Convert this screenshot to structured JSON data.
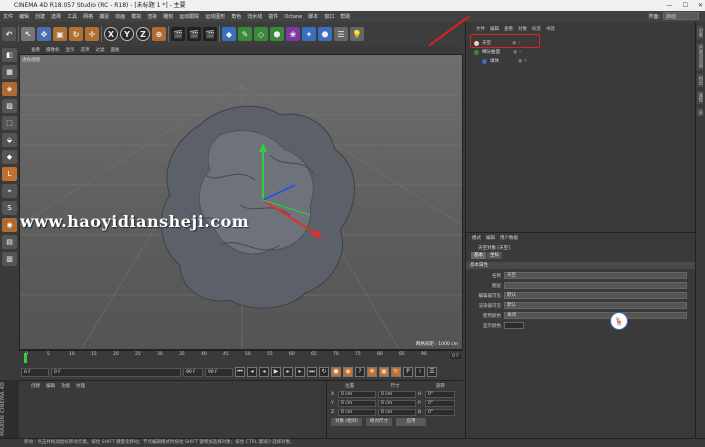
{
  "title": "CINEMA 4D R18.057 Studio (RC - R18) - [未标题 1 *] - 主要",
  "menu": [
    "文件",
    "编辑",
    "创建",
    "选择",
    "工具",
    "网格",
    "捕捉",
    "动画",
    "模拟",
    "渲染",
    "雕刻",
    "运动跟踪",
    "运动图形",
    "角色",
    "流水线",
    "插件",
    "Octane",
    "脚本",
    "窗口",
    "帮助"
  ],
  "layout_label": "界面:",
  "layout_value": "启动",
  "toolbar": [
    "↶",
    "↖",
    "✥",
    "▣",
    "↻",
    "✛",
    "X",
    "Y",
    "Z",
    "⊕",
    "🎬",
    "🎬",
    "🎬",
    "◆",
    "✎",
    "◇",
    "⬢",
    "❀",
    "✦",
    "⬣",
    "☰",
    "💡"
  ],
  "viewport_menu": [
    "查看",
    "摄像机",
    "显示",
    "选项",
    "过滤",
    "面板"
  ],
  "viewport_label": "透视视图",
  "viewport_distance": "网格间距 : 1000 cm",
  "watermark": "www.haoyidiansheji.com",
  "timeline_ticks": [
    "0",
    "5",
    "10",
    "15",
    "20",
    "25",
    "30",
    "35",
    "40",
    "45",
    "50",
    "55",
    "60",
    "65",
    "70",
    "75",
    "80",
    "85",
    "90"
  ],
  "timeline_end": "0 F",
  "playbar": {
    "start": "0 F",
    "cur": "0 F",
    "end": "90 F",
    "end2": "90 F"
  },
  "materials_menu": [
    "创建",
    "编辑",
    "功能",
    "纹理"
  ],
  "coords": {
    "headers": [
      "位置",
      "尺寸",
      "旋转"
    ],
    "rows": [
      {
        "a": "X",
        "p": "0 cm",
        "s": "0 cm",
        "ra": "H",
        "r": "0°"
      },
      {
        "a": "Y",
        "p": "0 cm",
        "s": "0 cm",
        "ra": "P",
        "r": "0°"
      },
      {
        "a": "Z",
        "p": "0 cm",
        "s": "0 cm",
        "ra": "B",
        "r": "0°"
      }
    ],
    "mode": "对象 (相对)",
    "size_mode": "绝对尺寸",
    "apply": "应用"
  },
  "status": "移动 : 点击并拖动鼠标移动元素。按住 SHIFT 键量化移动；节点编辑模式时按住 SHIFT 键增加选择对象；按住 CTRL 键减少选择对象。",
  "objmgr": {
    "menu": [
      "文件",
      "编辑",
      "查看",
      "对象",
      "标签",
      "书签"
    ],
    "items": [
      "天空",
      "细分曲面",
      "球体"
    ]
  },
  "attrmgr": {
    "menu": [
      "模式",
      "编辑",
      "用户数据"
    ],
    "title": "天空对象 [天空]",
    "tabs": [
      "基本",
      "坐标"
    ],
    "section": "基本属性",
    "props": [
      {
        "label": "名称",
        "value": "天空"
      },
      {
        "label": "图层",
        "value": ""
      },
      {
        "label": "编辑器可见",
        "value": "默认"
      },
      {
        "label": "渲染器可见",
        "value": "默认"
      },
      {
        "label": "使用颜色",
        "value": "关闭"
      },
      {
        "label": "显示颜色",
        "value": ""
      }
    ]
  },
  "rightstrip": [
    "对象",
    "内容浏览器",
    "构造",
    "属性",
    "层"
  ],
  "maxon": "MAXON CINEMA 4D"
}
